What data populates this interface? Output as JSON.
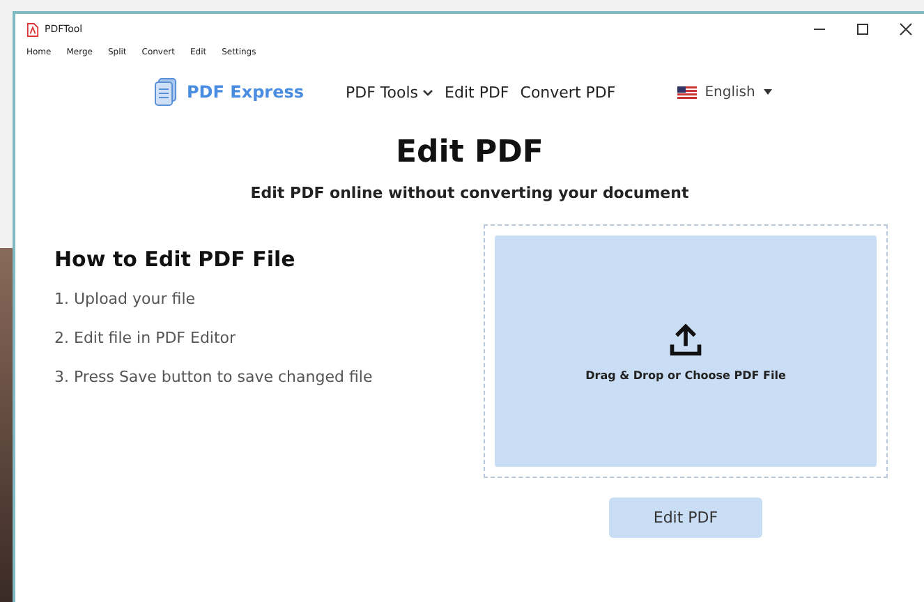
{
  "window": {
    "title": "PDFTool"
  },
  "menu": [
    "Home",
    "Merge",
    "Split",
    "Convert",
    "Edit",
    "Settings"
  ],
  "nav": {
    "brand": "PDF Express",
    "links": [
      {
        "label": "PDF Tools",
        "dropdown": true
      },
      {
        "label": "Edit PDF",
        "dropdown": false
      },
      {
        "label": "Convert PDF",
        "dropdown": false
      }
    ],
    "language": "English"
  },
  "page": {
    "title": "Edit PDF",
    "subtitle": "Edit PDF online without converting your document"
  },
  "howto": {
    "heading": "How to Edit PDF File",
    "steps": [
      "1. Upload your file",
      "2. Edit file in PDF Editor",
      "3. Press Save button to save changed file"
    ]
  },
  "dropzone": {
    "label": "Drag & Drop or Choose PDF File"
  },
  "action_button": "Edit PDF"
}
